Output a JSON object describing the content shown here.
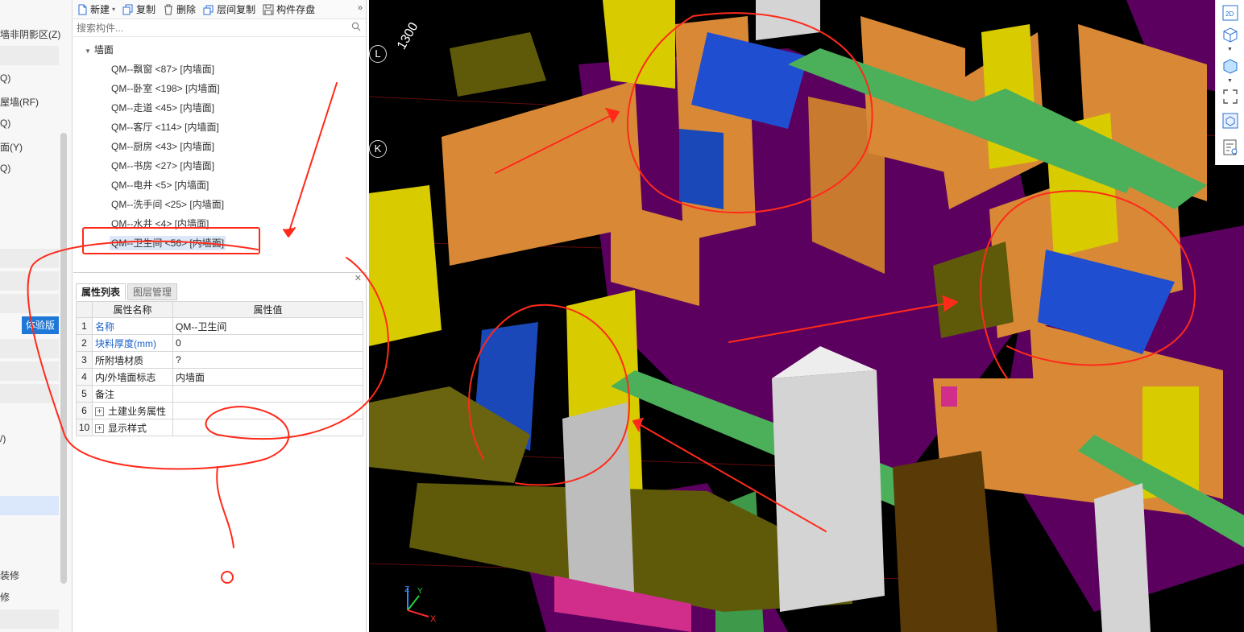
{
  "left_nav": {
    "items": [
      "墙非阴影区(Z)",
      "Q)",
      "屋墙(RF)",
      "Q)",
      "面(Y)",
      "Q)",
      "/)",
      "装修",
      "修"
    ],
    "badge": "体验版"
  },
  "toolbar": {
    "new_label": "新建",
    "copy_label": "复制",
    "delete_label": "删除",
    "floor_copy_label": "层间复制",
    "save_component_label": "构件存盘",
    "more": "»"
  },
  "search": {
    "placeholder": "搜索构件..."
  },
  "tree": {
    "root_label": "墙面",
    "items": [
      "QM--飘窗 <87> [内墙面]",
      "QM--卧室 <198> [内墙面]",
      "QM--走道 <45> [内墙面]",
      "QM--客厅 <114> [内墙面]",
      "QM--厨房 <43> [内墙面]",
      "QM--书房 <27> [内墙面]",
      "QM--电井 <5> [内墙面]",
      "QM--洗手间 <25> [内墙面]",
      "QM--水井 <4> [内墙面]",
      "QM--卫生间 <56> [内墙面]"
    ],
    "selected_index": 9
  },
  "properties": {
    "tabs": [
      "属性列表",
      "图层管理"
    ],
    "header": {
      "name": "属性名称",
      "value": "属性值"
    },
    "rows": [
      {
        "num": "1",
        "name": "名称",
        "value": "QM--卫生间",
        "blue": true
      },
      {
        "num": "2",
        "name": "块料厚度(mm)",
        "value": "0",
        "blue": true
      },
      {
        "num": "3",
        "name": "所附墙材质",
        "value": "?"
      },
      {
        "num": "4",
        "name": "内/外墙面标志",
        "value": "内墙面"
      },
      {
        "num": "5",
        "name": "备注",
        "value": ""
      },
      {
        "num": "6",
        "name": "土建业务属性",
        "value": "",
        "expandable": true
      },
      {
        "num": "10",
        "name": "显示样式",
        "value": "",
        "expandable": true
      }
    ]
  },
  "viewport": {
    "grid_labels": [
      "L",
      "K"
    ],
    "dimension": "1300",
    "axes": [
      "Z",
      "Y",
      "X"
    ]
  },
  "view_tools": {
    "label_2d": "2D"
  },
  "colors": {
    "floor": "#5c0060",
    "wall_orange": "#d98936",
    "wall_yellow": "#d8cc00",
    "beam_olive": "#5e5a0a",
    "green": "#4caf5a",
    "blue": "#1f4fd0",
    "grey_wall": "#d4d4d4",
    "annotation": "#ff2a1a",
    "selection": "#dce7f7",
    "badge": "#1e78d8"
  }
}
